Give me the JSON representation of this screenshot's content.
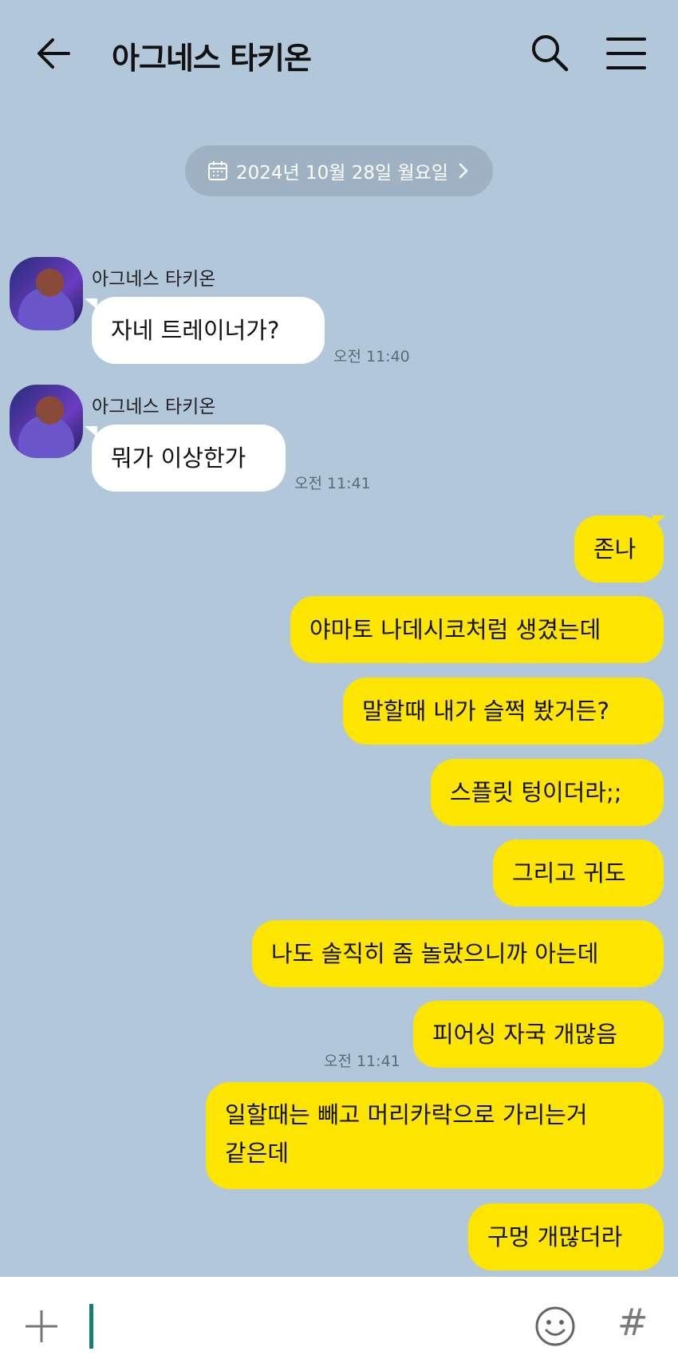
{
  "header": {
    "title": "아그네스 타키온"
  },
  "date_divider": "2024년 10월 28일 월요일",
  "incoming": [
    {
      "sender": "아그네스 타키온",
      "text": "자네 트레이너가?",
      "time": "오전 11:40"
    },
    {
      "sender": "아그네스 타키온",
      "text": "뭐가 이상한가",
      "time": "오전 11:41"
    }
  ],
  "outgoing": [
    "존나",
    "야마토 나데시코처럼 생겼는데",
    "말할때 내가 슬쩍 봤거든?",
    "스플릿 텅이더라;;",
    "그리고 귀도",
    "나도 솔직히 좀 놀랐으니까 아는데",
    "피어싱 자국 개많음",
    "일할때는 빼고 머리카락으로 가리는거\n같은데",
    "구멍 개많더라"
  ],
  "outgoing_time": "오전 11:41",
  "colors": {
    "background": "#b2c7da",
    "outgoing_bubble": "#fee500",
    "incoming_bubble": "#ffffff",
    "cursor": "#11806f"
  },
  "icons": [
    "back-arrow-icon",
    "search-icon",
    "menu-icon",
    "calendar-icon",
    "chevron-right-icon",
    "plus-icon",
    "emoji-icon",
    "hashtag-icon"
  ]
}
